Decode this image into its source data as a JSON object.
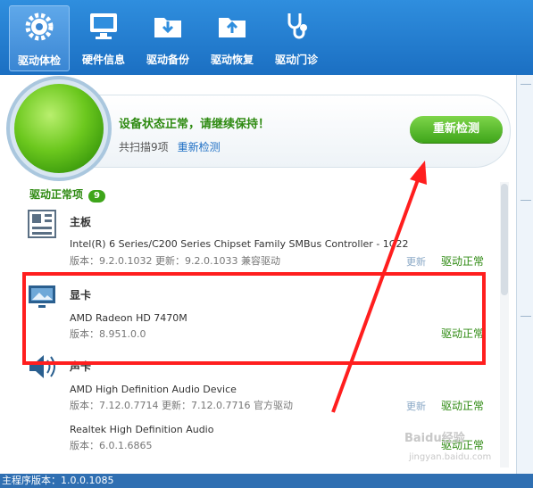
{
  "toolbar": {
    "items": [
      {
        "label": "驱动体检",
        "icon": "stethoscope-gear-icon",
        "active": true
      },
      {
        "label": "硬件信息",
        "icon": "monitor-icon"
      },
      {
        "label": "驱动备份",
        "icon": "folder-download-icon"
      },
      {
        "label": "驱动恢复",
        "icon": "folder-upload-icon"
      },
      {
        "label": "驱动门诊",
        "icon": "stethoscope-icon"
      }
    ]
  },
  "status": {
    "title": "设备状态正常，请继续保持！",
    "scanned_prefix": "共扫描",
    "scanned_count": "9",
    "scanned_suffix": "项",
    "rescan_link": "重新检测",
    "rescan_button": "重新检测"
  },
  "section": {
    "title": "驱动正常项",
    "count": "9"
  },
  "items": [
    {
      "name": "主板",
      "desc": "Intel(R) 6 Series/C200 Series Chipset Family SMBus Controller - 1C22",
      "version": "版本：9.2.0.1032 更新：9.2.0.1033 兼容驱动",
      "update": "更新",
      "status": "驱动正常",
      "icon": "motherboard-icon"
    },
    {
      "name": "显卡",
      "desc": "AMD Radeon HD 7470M",
      "version": "版本：8.951.0.0",
      "status": "驱动正常",
      "icon": "display-icon"
    },
    {
      "name": "声卡",
      "desc": "AMD High Definition Audio Device",
      "version": "版本：7.12.0.7714 更新：7.12.0.7716 官方驱动",
      "update": "更新",
      "status": "驱动正常",
      "icon": "speaker-icon"
    },
    {
      "desc": "Realtek High Definition Audio",
      "version": "版本：6.0.1.6865",
      "status": "驱动正常"
    }
  ],
  "footer": {
    "version": "主程序版本：1.0.0.1085"
  },
  "watermark": {
    "brand": "Baidu经验",
    "url": "jingyan.baidu.com"
  },
  "colors": {
    "toolbar": "#1b6fc2",
    "ok_green": "#2e8a11",
    "annotation_red": "#ff1e1e"
  }
}
